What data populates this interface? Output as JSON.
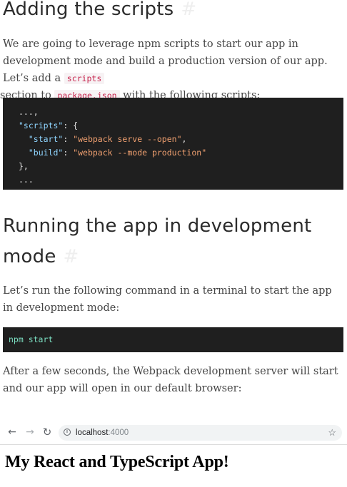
{
  "section1": {
    "heading": "Adding the scripts",
    "anchor": "#",
    "para_before_scripts": "We are going to leverage npm scripts to start our app in development mode and build a production version of our app. Let’s add a ",
    "code_scripts": "scripts",
    "para_section_to": " section to ",
    "code_package": "package.json",
    "para_after": " with the following scripts:"
  },
  "code1": {
    "line1": "...,",
    "scripts_key": "\"scripts\"",
    "scripts_rest": ": {",
    "start_key": "\"start\"",
    "start_val": "\"webpack serve --open\"",
    "build_key": "\"build\"",
    "build_val": "\"webpack --mode production\"",
    "close": "},",
    "ellipsis": "..."
  },
  "section2": {
    "heading_line1": "Running the app in development",
    "heading_line2": "mode",
    "anchor": "#",
    "para": "Let’s run the following command in a terminal to start the app in development mode:"
  },
  "code2": {
    "command": "npm start"
  },
  "para3": "After a few seconds, the Webpack development server will start and our app will open in our default browser:",
  "browser": {
    "back_icon": "arrow-left-icon",
    "forward_icon": "arrow-right-icon",
    "reload_icon": "reload-icon",
    "info_icon": "info-icon",
    "host": "localhost",
    "port": ":4000",
    "bookmark_icon": "star-icon",
    "page_heading": "My React and TypeScript App!"
  }
}
